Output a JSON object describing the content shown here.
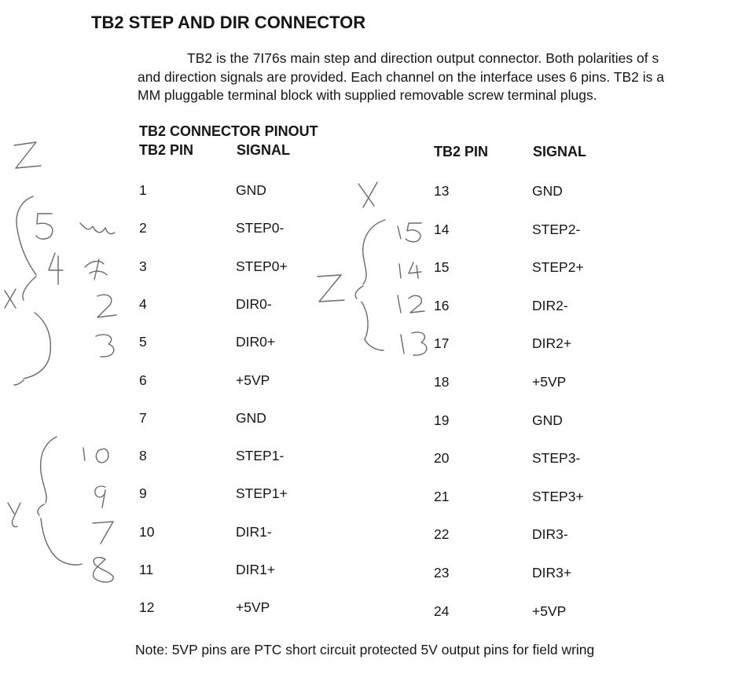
{
  "title": "TB2 STEP AND DIR CONNECTOR",
  "paragraph": [
    "TB2 is the 7I76s main step and direction output connector. Both polarities of s",
    "and direction signals are provided. Each channel on the interface uses 6 pins. TB2 is a",
    "MM pluggable terminal block with supplied removable screw terminal plugs."
  ],
  "subtitle": "TB2 CONNECTOR PINOUT",
  "headers": {
    "left_pin": "TB2 PIN",
    "left_signal": "SIGNAL",
    "right_pin": "TB2 PIN",
    "right_signal": "SIGNAL"
  },
  "rows": [
    {
      "lp": "1",
      "ls": "GND",
      "rp": "13",
      "rs": "GND"
    },
    {
      "lp": "2",
      "ls": "STEP0-",
      "rp": "14",
      "rs": "STEP2-"
    },
    {
      "lp": "3",
      "ls": "STEP0+",
      "rp": "15",
      "rs": "STEP2+"
    },
    {
      "lp": "4",
      "ls": "DIR0-",
      "rp": "16",
      "rs": "DIR2-"
    },
    {
      "lp": "5",
      "ls": "DIR0+",
      "rp": "17",
      "rs": "DIR2+"
    },
    {
      "lp": "6",
      "ls": "+5VP",
      "rp": "18",
      "rs": "+5VP"
    },
    {
      "lp": "7",
      "ls": "GND",
      "rp": "19",
      "rs": "GND"
    },
    {
      "lp": "8",
      "ls": "STEP1-",
      "rp": "20",
      "rs": "STEP3-"
    },
    {
      "lp": "9",
      "ls": "STEP1+",
      "rp": "21",
      "rs": "STEP3+"
    },
    {
      "lp": "10",
      "ls": "DIR1-",
      "rp": "22",
      "rs": "DIR3-"
    },
    {
      "lp": "11",
      "ls": "DIR1+",
      "rp": "23",
      "rs": "DIR3+"
    },
    {
      "lp": "12",
      "ls": "+5VP",
      "rp": "24",
      "rs": "+5VP"
    }
  ],
  "note": "Note: 5VP pins are PTC short circuit protected 5V output pins for field wring"
}
